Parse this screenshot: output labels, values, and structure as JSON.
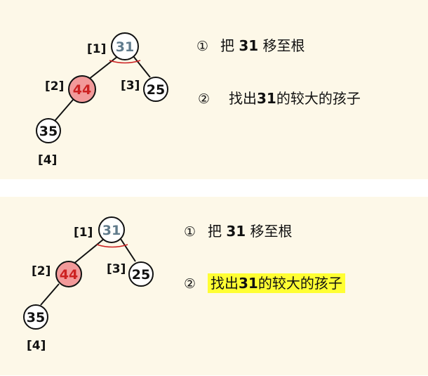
{
  "colors": {
    "panel_bg": "#fdf8e8",
    "node_fill": "#ffffff",
    "highlight_node_fill": "#f29a9a",
    "highlight_text": "#ffff33",
    "root_text": "#607b8c",
    "mark": "#cc2222"
  },
  "panels": [
    {
      "nodes": [
        {
          "value": "31",
          "index": "[1]"
        },
        {
          "value": "44",
          "index": "[2]"
        },
        {
          "value": "25",
          "index": "[3]"
        },
        {
          "value": "35",
          "index": "[4]"
        }
      ],
      "steps": [
        {
          "marker": "①",
          "pre": "把 ",
          "bold": "31",
          "post": " 移至根"
        },
        {
          "marker": "②",
          "pre": "找出",
          "bold": "31",
          "post": "的较大的孩子"
        }
      ]
    },
    {
      "nodes": [
        {
          "value": "31",
          "index": "[1]"
        },
        {
          "value": "44",
          "index": "[2]"
        },
        {
          "value": "25",
          "index": "[3]"
        },
        {
          "value": "35",
          "index": "[4]"
        }
      ],
      "steps": [
        {
          "marker": "①",
          "pre": "把 ",
          "bold": "31",
          "post": " 移至根"
        },
        {
          "marker": "②",
          "pre": "找出",
          "bold": "31",
          "post": "的较大的孩子"
        }
      ]
    }
  ]
}
